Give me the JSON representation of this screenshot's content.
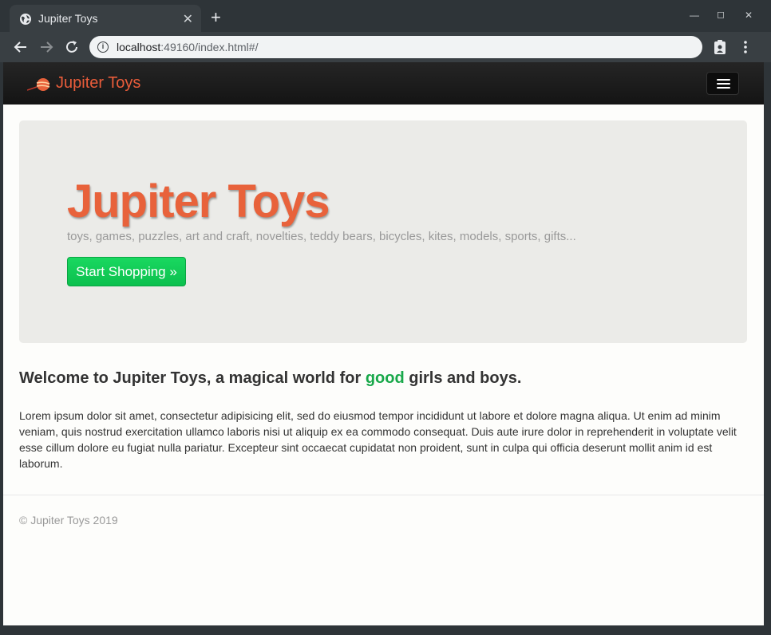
{
  "browser": {
    "tab_title": "Jupiter Toys",
    "tab_close": "✕",
    "new_tab": "+",
    "url_host": "localhost",
    "url_rest": ":49160/index.html#/",
    "icons": {
      "favicon": "globe-icon",
      "back": "arrow-left-icon",
      "forward": "arrow-right-icon",
      "reload": "reload-icon",
      "info": "info-icon",
      "clipboard": "clipboard-icon",
      "menu": "kebab-menu-icon"
    }
  },
  "navbar": {
    "brand": "Jupiter Toys",
    "brand_color": "#e95c3a"
  },
  "hero": {
    "title": "Jupiter Toys",
    "tagline": "toys, games, puzzles, art and craft, novelties, teddy bears, bicycles, kites, models, sports, gifts...",
    "cta_label": "Start Shopping »"
  },
  "content": {
    "welcome_before": "Welcome to Jupiter Toys, a magical world for ",
    "welcome_highlight": "good",
    "welcome_after": " girls and boys.",
    "body": "Lorem ipsum dolor sit amet, consectetur adipisicing elit, sed do eiusmod tempor incididunt ut labore et dolore magna aliqua. Ut enim ad minim veniam, quis nostrud exercitation ullamco laboris nisi ut aliquip ex ea commodo consequat. Duis aute irure dolor in reprehenderit in voluptate velit esse cillum dolore eu fugiat nulla pariatur. Excepteur sint occaecat cupidatat non proident, sunt in culpa qui officia deserunt mollit anim id est laborum."
  },
  "footer": {
    "copyright": "© Jupiter Toys 2019"
  }
}
